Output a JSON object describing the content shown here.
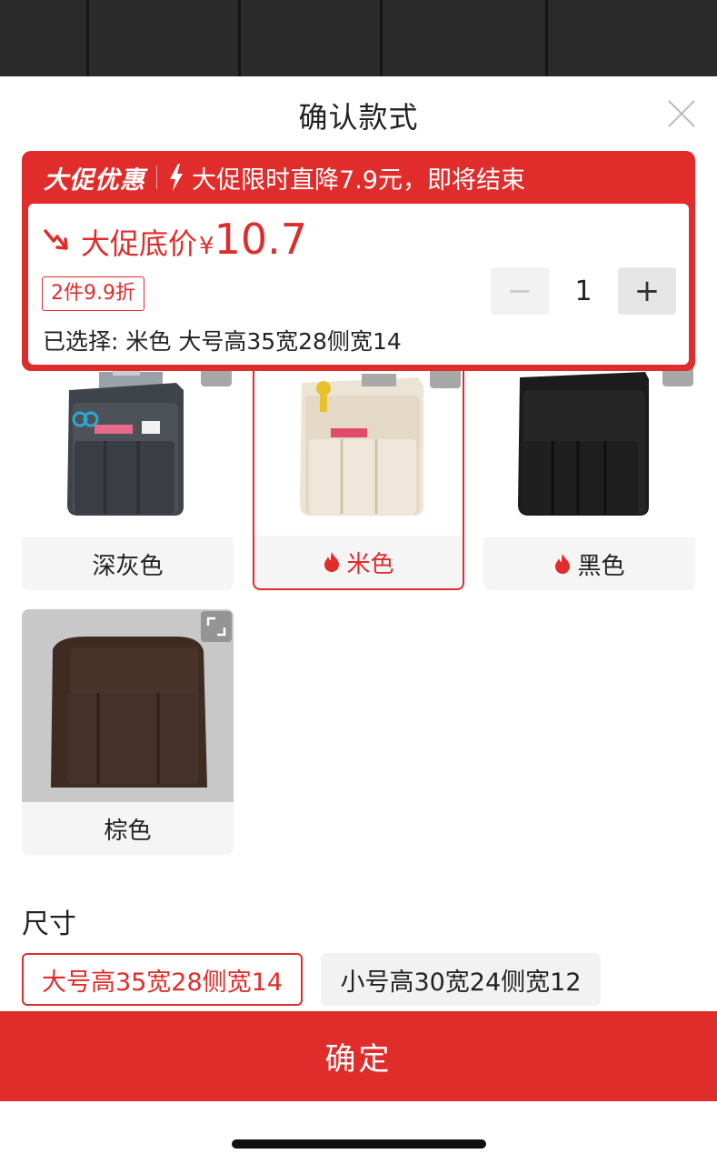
{
  "sheet": {
    "title": "确认款式"
  },
  "promo": {
    "tag": "大促优惠",
    "message": "大促限时直降7.9元，即将结束",
    "price_label": "大促底价",
    "currency": "¥",
    "price": "10.7",
    "discount": "2件9.9折",
    "selected": "已选择: 米色 大号高35宽28侧宽14",
    "quantity": "1",
    "minus": "−",
    "plus": "+"
  },
  "colors": [
    {
      "label": "深灰色",
      "hot": false,
      "selected": false
    },
    {
      "label": "米色",
      "hot": true,
      "selected": true
    },
    {
      "label": "黑色",
      "hot": true,
      "selected": false
    },
    {
      "label": "棕色",
      "hot": false,
      "selected": false
    }
  ],
  "size": {
    "title": "尺寸",
    "options": [
      {
        "label": "大号高35宽28侧宽14",
        "active": true
      },
      {
        "label": "小号高30宽24侧宽12",
        "active": false
      }
    ]
  },
  "footer": {
    "confirm_label": "确定"
  },
  "theme": {
    "accent": "#e02c2b"
  }
}
